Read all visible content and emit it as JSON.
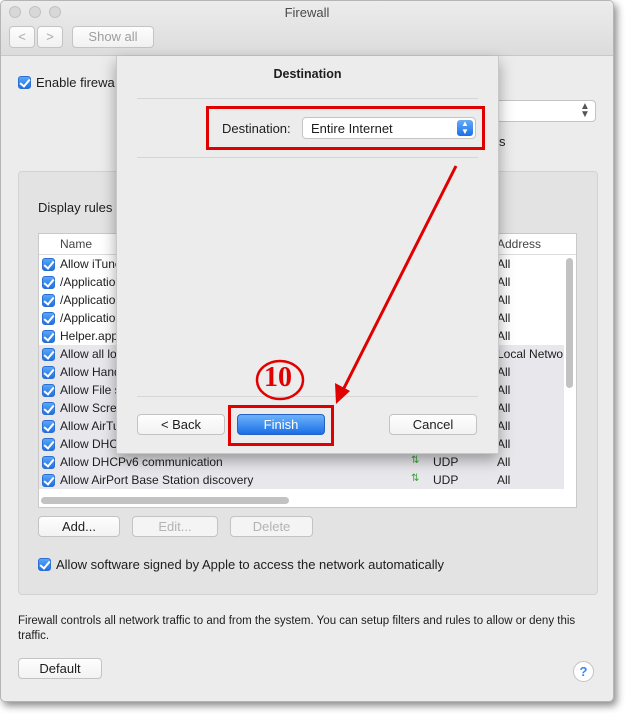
{
  "window": {
    "title": "Firewall"
  },
  "toolbar": {
    "back": "<",
    "forward": ">",
    "show_all": "Show all"
  },
  "enable_firewall": {
    "label": "Enable firewa",
    "checked": true
  },
  "behind_text": "s",
  "panel": {
    "display_rules": "Display rules"
  },
  "table": {
    "columns": {
      "name": "Name",
      "address": "Address"
    },
    "rows": [
      {
        "name": "Allow iTune",
        "proto": "",
        "address": "All",
        "checked": true,
        "shaded": false
      },
      {
        "name": "/Application",
        "proto": "",
        "address": "All",
        "checked": true,
        "shaded": false
      },
      {
        "name": "/Application",
        "proto": "",
        "address": "All",
        "checked": true,
        "shaded": false
      },
      {
        "name": "/Application",
        "proto": "",
        "address": "All",
        "checked": true,
        "shaded": false
      },
      {
        "name": "Helper.app/",
        "proto": "",
        "address": "All",
        "checked": true,
        "shaded": false
      },
      {
        "name": "Allow all loc",
        "proto": "",
        "address": "Local Netwo",
        "checked": true,
        "shaded": true
      },
      {
        "name": "Allow Hand",
        "proto": "",
        "address": "All",
        "checked": true,
        "shaded": true
      },
      {
        "name": "Allow File s",
        "proto": "",
        "address": "All",
        "checked": true,
        "shaded": true
      },
      {
        "name": "Allow Scree",
        "proto": "",
        "address": "All",
        "checked": true,
        "shaded": true
      },
      {
        "name": "Allow AirTu",
        "proto": "",
        "address": "All",
        "checked": true,
        "shaded": true
      },
      {
        "name": "Allow DHCP",
        "proto": "",
        "address": "All",
        "checked": true,
        "shaded": true
      },
      {
        "name": "Allow DHCPv6 communication",
        "proto": "UDP",
        "address": "All",
        "checked": true,
        "shaded": true
      },
      {
        "name": "Allow AirPort Base Station discovery",
        "proto": "UDP",
        "address": "All",
        "checked": true,
        "shaded": true
      }
    ]
  },
  "buttons": {
    "add": "Add...",
    "edit": "Edit...",
    "delete": "Delete",
    "default": "Default",
    "help": "?"
  },
  "allow_signed": {
    "label": "Allow software signed by Apple to access the network automatically",
    "checked": true
  },
  "footer_text": "Firewall controls all network traffic to and from the system. You can setup filters and rules to allow or deny this traffic.",
  "sheet": {
    "title": "Destination",
    "destination_label": "Destination:",
    "destination_value": "Entire Internet",
    "back": "< Back",
    "finish": "Finish",
    "cancel": "Cancel"
  },
  "annotation": {
    "step": "10",
    "color": "#e00000"
  },
  "colors": {
    "accent": "#1a6fe6",
    "window_bg": "#ececec"
  }
}
